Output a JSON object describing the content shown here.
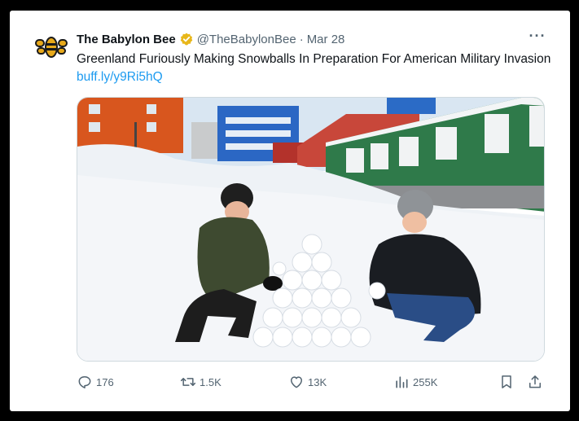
{
  "tweet": {
    "author_name": "The Babylon Bee",
    "handle": "@TheBabylonBee",
    "separator": "·",
    "date": "Mar 28",
    "more_label": "···",
    "text": "Greenland Furiously Making Snowballs In Preparation For American Military Invasion",
    "link": "buff.ly/y9Ri5hQ"
  },
  "icons": {
    "avatar": "babylon-bee-logo",
    "verified": "verified-badge-icon",
    "more": "more-icon",
    "reply": "reply-icon",
    "retweet": "retweet-icon",
    "like": "heart-icon",
    "views": "views-icon",
    "bookmark": "bookmark-icon",
    "share": "share-icon"
  },
  "actions": {
    "replies": "176",
    "retweets": "1.5K",
    "likes": "13K",
    "views": "255K"
  },
  "colors": {
    "link": "#1d9bf0",
    "verified_badge": "#e8b71a",
    "icon_gray": "#536471",
    "frame_border": "#000000"
  }
}
